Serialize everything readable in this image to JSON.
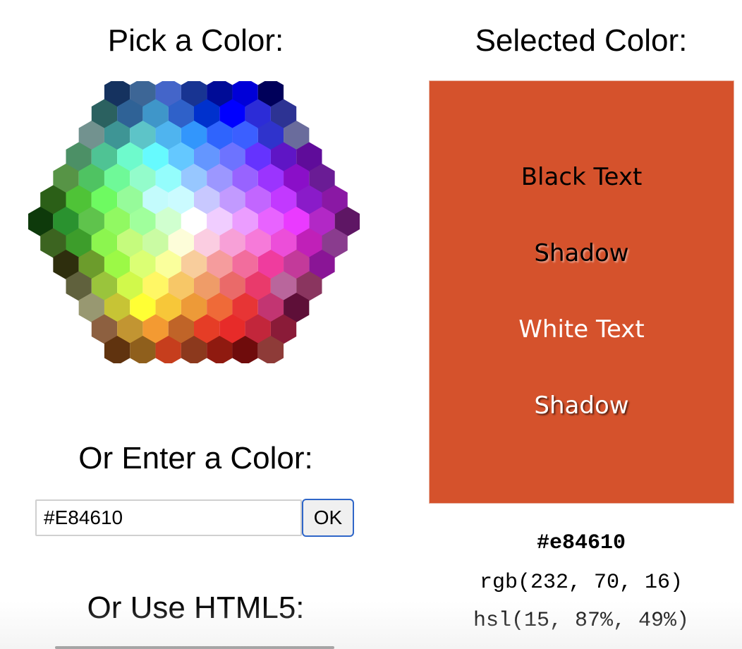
{
  "headings": {
    "pick": "Pick a Color:",
    "selected": "Selected Color:",
    "enter": "Or Enter a Color:",
    "html5": "Or Use HTML5:"
  },
  "input": {
    "value": "#E84610"
  },
  "ok_button": {
    "label": "OK"
  },
  "selected": {
    "color": "#d5522c",
    "samples": {
      "black_text": "Black Text",
      "shadow_dark": "Shadow",
      "white_text": "White Text",
      "shadow_light": "Shadow"
    },
    "hex": "#e84610",
    "rgb": "rgb(232, 70, 16)",
    "hsl": "hsl(15, 87%, 49%)"
  },
  "palette": {
    "rows": [
      [
        "#15325f",
        "#3d6696",
        "#4465c9",
        "#183492",
        "#000c97",
        "#0000d8",
        "#00005a"
      ],
      [
        "#2b6160",
        "#2f6296",
        "#3f96c9",
        "#2f61c9",
        "#0031cd",
        "#0000ff",
        "#2c2cd7",
        "#2d3393"
      ],
      [
        "#72928f",
        "#3e9595",
        "#5dc4c8",
        "#4fb4ef",
        "#3296fc",
        "#2f64fd",
        "#3b5fff",
        "#2f33cc",
        "#6a6c9c"
      ],
      [
        "#4c9066",
        "#4fc394",
        "#6efacc",
        "#66fafe",
        "#64c8ff",
        "#6496ff",
        "#6d73ff",
        "#6533fe",
        "#5f15c5",
        "#5f0c9a"
      ],
      [
        "#579446",
        "#4fc362",
        "#6ff998",
        "#93fccb",
        "#94fdfc",
        "#97c7ff",
        "#9c97ff",
        "#9863ff",
        "#9b34fe",
        "#8a0fc8",
        "#6a1c95"
      ],
      [
        "#2b5f17",
        "#4fc337",
        "#6efa61",
        "#96fb9a",
        "#c3fbfc",
        "#cbfbff",
        "#c8c8ff",
        "#c29aff",
        "#c266ff",
        "#c239ff",
        "#8a1bc9",
        "#8a18a4"
      ],
      [
        "#0e3a0b",
        "#2a922f",
        "#5fc34c",
        "#91f962",
        "#a0ff9c",
        "#d0ffcf",
        "#ffffff",
        "#f0cdff",
        "#eb9dff",
        "#e863ff",
        "#ea3aff",
        "#b228c6",
        "#5e1664"
      ],
      [
        "#3c6420",
        "#3d9d2b",
        "#8cf54f",
        "#c5fb7d",
        "#cafba3",
        "#fdfdd9",
        "#fbcde1",
        "#f7a0d7",
        "#f67ad9",
        "#ec4ed9",
        "#c020b8",
        "#8a3c8e"
      ],
      [
        "#2e2e0d",
        "#6c9c2c",
        "#9cf946",
        "#dbff74",
        "#faff9c",
        "#f8cd9c",
        "#f59c9d",
        "#f26d9d",
        "#ef3c9e",
        "#c33a9a",
        "#8a1596"
      ],
      [
        "#60613d",
        "#9ac43c",
        "#d1f94b",
        "#fff765",
        "#f7c767",
        "#ef9c68",
        "#ea6a69",
        "#e93a6b",
        "#b9669c",
        "#8a355f"
      ],
      [
        "#989871",
        "#c7c435",
        "#ffff34",
        "#f7c739",
        "#ed9a38",
        "#ef6a38",
        "#e73535",
        "#c23572",
        "#5e0f38"
      ],
      [
        "#8d6040",
        "#c29532",
        "#f39a32",
        "#c06428",
        "#e53d26",
        "#e72b29",
        "#c2263b",
        "#8a1b38"
      ],
      [
        "#60330f",
        "#8f5f1c",
        "#c63e1d",
        "#8c391d",
        "#8f1a10",
        "#6f0c0c",
        "#8e3b38"
      ]
    ]
  }
}
